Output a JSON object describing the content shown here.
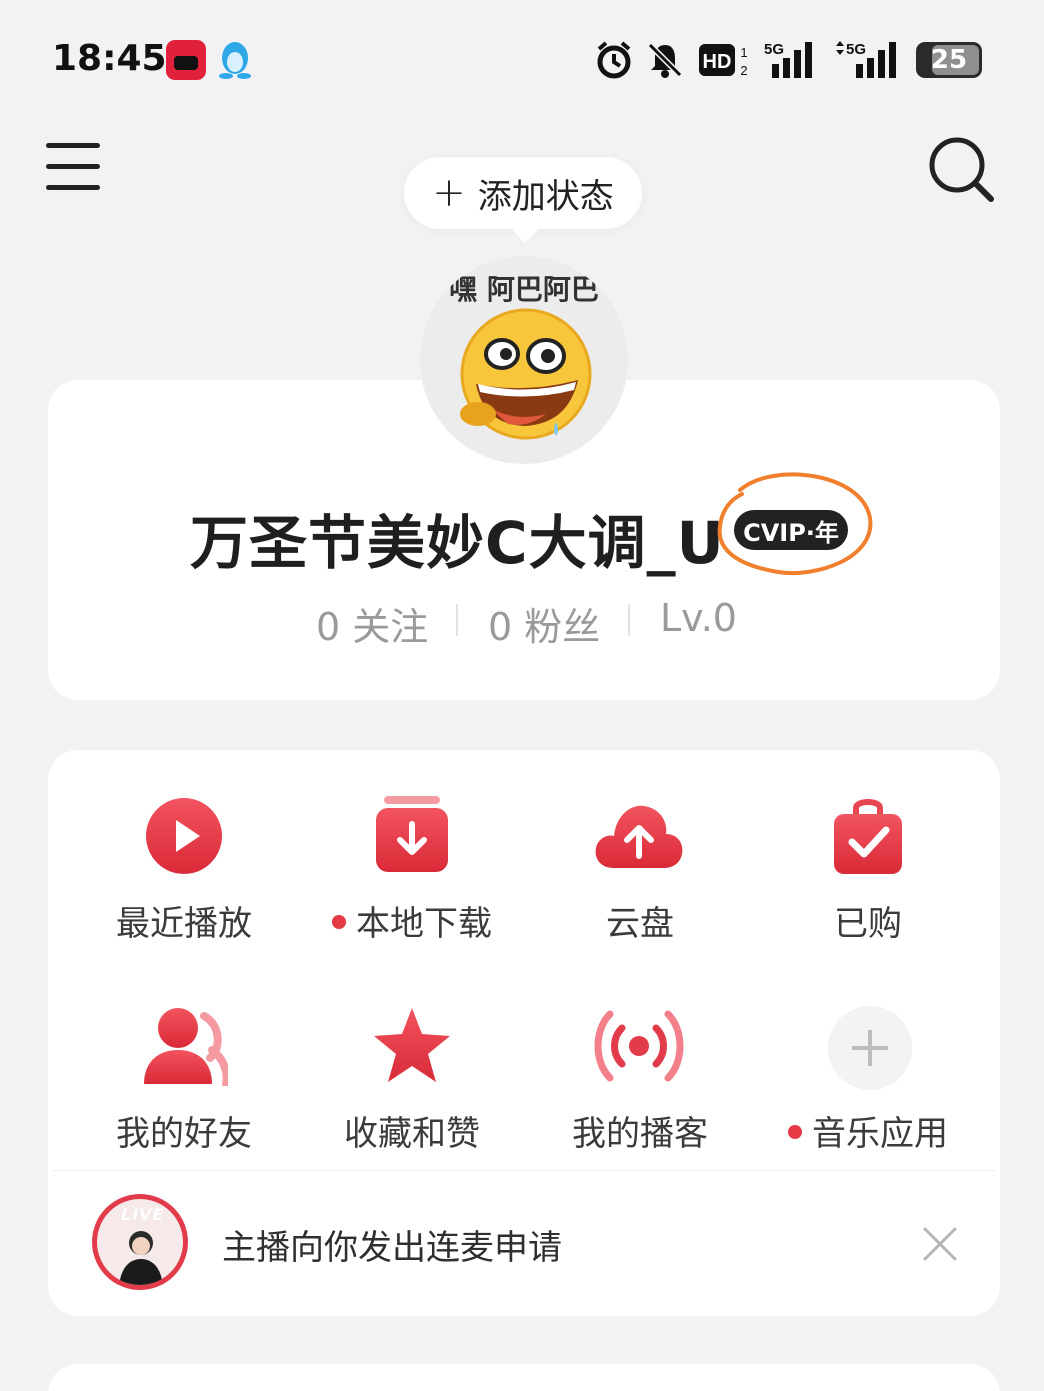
{
  "status_bar": {
    "time": "18:45",
    "network": "5G",
    "battery": "25"
  },
  "header": {
    "add_status_plus": "+",
    "add_status_label": "添加状态"
  },
  "profile": {
    "avatar_caption": "嘿 阿巴阿巴",
    "username": "万圣节美妙C大调_U",
    "vip_badge": "CVIP·年",
    "follow": "0 关注",
    "fans": "0 粉丝",
    "level": "Lv.0"
  },
  "grid": {
    "items": [
      {
        "label": "最近播放",
        "icon": "play-icon",
        "dot": false
      },
      {
        "label": "本地下载",
        "icon": "download-icon",
        "dot": true
      },
      {
        "label": "云盘",
        "icon": "cloud-upload-icon",
        "dot": false
      },
      {
        "label": "已购",
        "icon": "shopping-bag-icon",
        "dot": false
      },
      {
        "label": "我的好友",
        "icon": "friends-icon",
        "dot": false
      },
      {
        "label": "收藏和赞",
        "icon": "star-icon",
        "dot": false
      },
      {
        "label": "我的播客",
        "icon": "podcast-icon",
        "dot": false
      },
      {
        "label": "音乐应用",
        "icon": "add-icon",
        "dot": true
      }
    ]
  },
  "live_banner": {
    "badge": "LIVE",
    "text": "主播向你发出连麦申请"
  },
  "colors": {
    "accent": "#e63946",
    "background": "#f2f2f4",
    "card": "#ffffff",
    "annotation": "#f07f2e"
  }
}
